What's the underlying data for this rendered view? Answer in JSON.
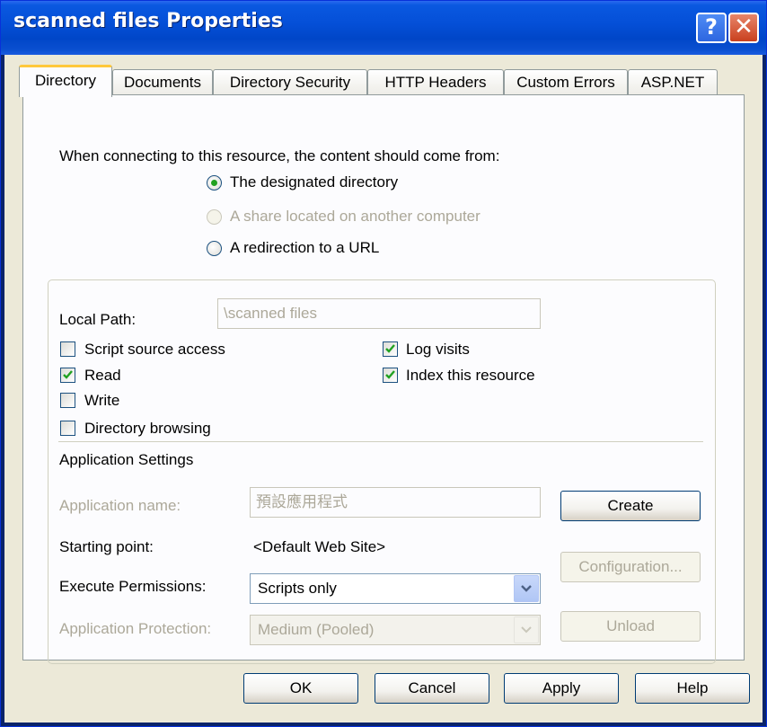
{
  "window": {
    "title": "scanned files Properties",
    "help_label": "?",
    "close_label": "✕"
  },
  "tabs": [
    "Directory",
    "Documents",
    "Directory Security",
    "HTTP Headers",
    "Custom Errors",
    "ASP.NET"
  ],
  "content_source": {
    "prompt": "When connecting to this resource, the content should come from:",
    "options": [
      {
        "label": "The designated directory",
        "selected": true,
        "enabled": true
      },
      {
        "label": "A share located on another computer",
        "selected": false,
        "enabled": false
      },
      {
        "label": "A redirection to a URL",
        "selected": false,
        "enabled": true
      }
    ]
  },
  "local_path": {
    "label": "Local Path:",
    "value": "\\scanned files"
  },
  "checkboxes": [
    {
      "label": "Script source access",
      "checked": false
    },
    {
      "label": "Read",
      "checked": true
    },
    {
      "label": "Write",
      "checked": false
    },
    {
      "label": "Directory browsing",
      "checked": false
    },
    {
      "label": "Log visits",
      "checked": true
    },
    {
      "label": "Index this resource",
      "checked": true
    }
  ],
  "app_settings": {
    "heading": "Application Settings",
    "app_name_label": "Application name:",
    "app_name_value": "預設應用程式",
    "create_label": "Create",
    "starting_point_label": "Starting point:",
    "starting_point_value": "<Default Web Site>",
    "configuration_label": "Configuration...",
    "execute_label": "Execute Permissions:",
    "execute_value": "Scripts only",
    "protection_label": "Application Protection:",
    "protection_value": "Medium (Pooled)",
    "unload_label": "Unload"
  },
  "footer": {
    "ok": "OK",
    "cancel": "Cancel",
    "apply": "Apply",
    "help": "Help"
  },
  "colors": {
    "titlebar": "#0550d8",
    "face": "#ece9d8",
    "check": "#21a121",
    "tab_highlight": "#ffc83c"
  }
}
